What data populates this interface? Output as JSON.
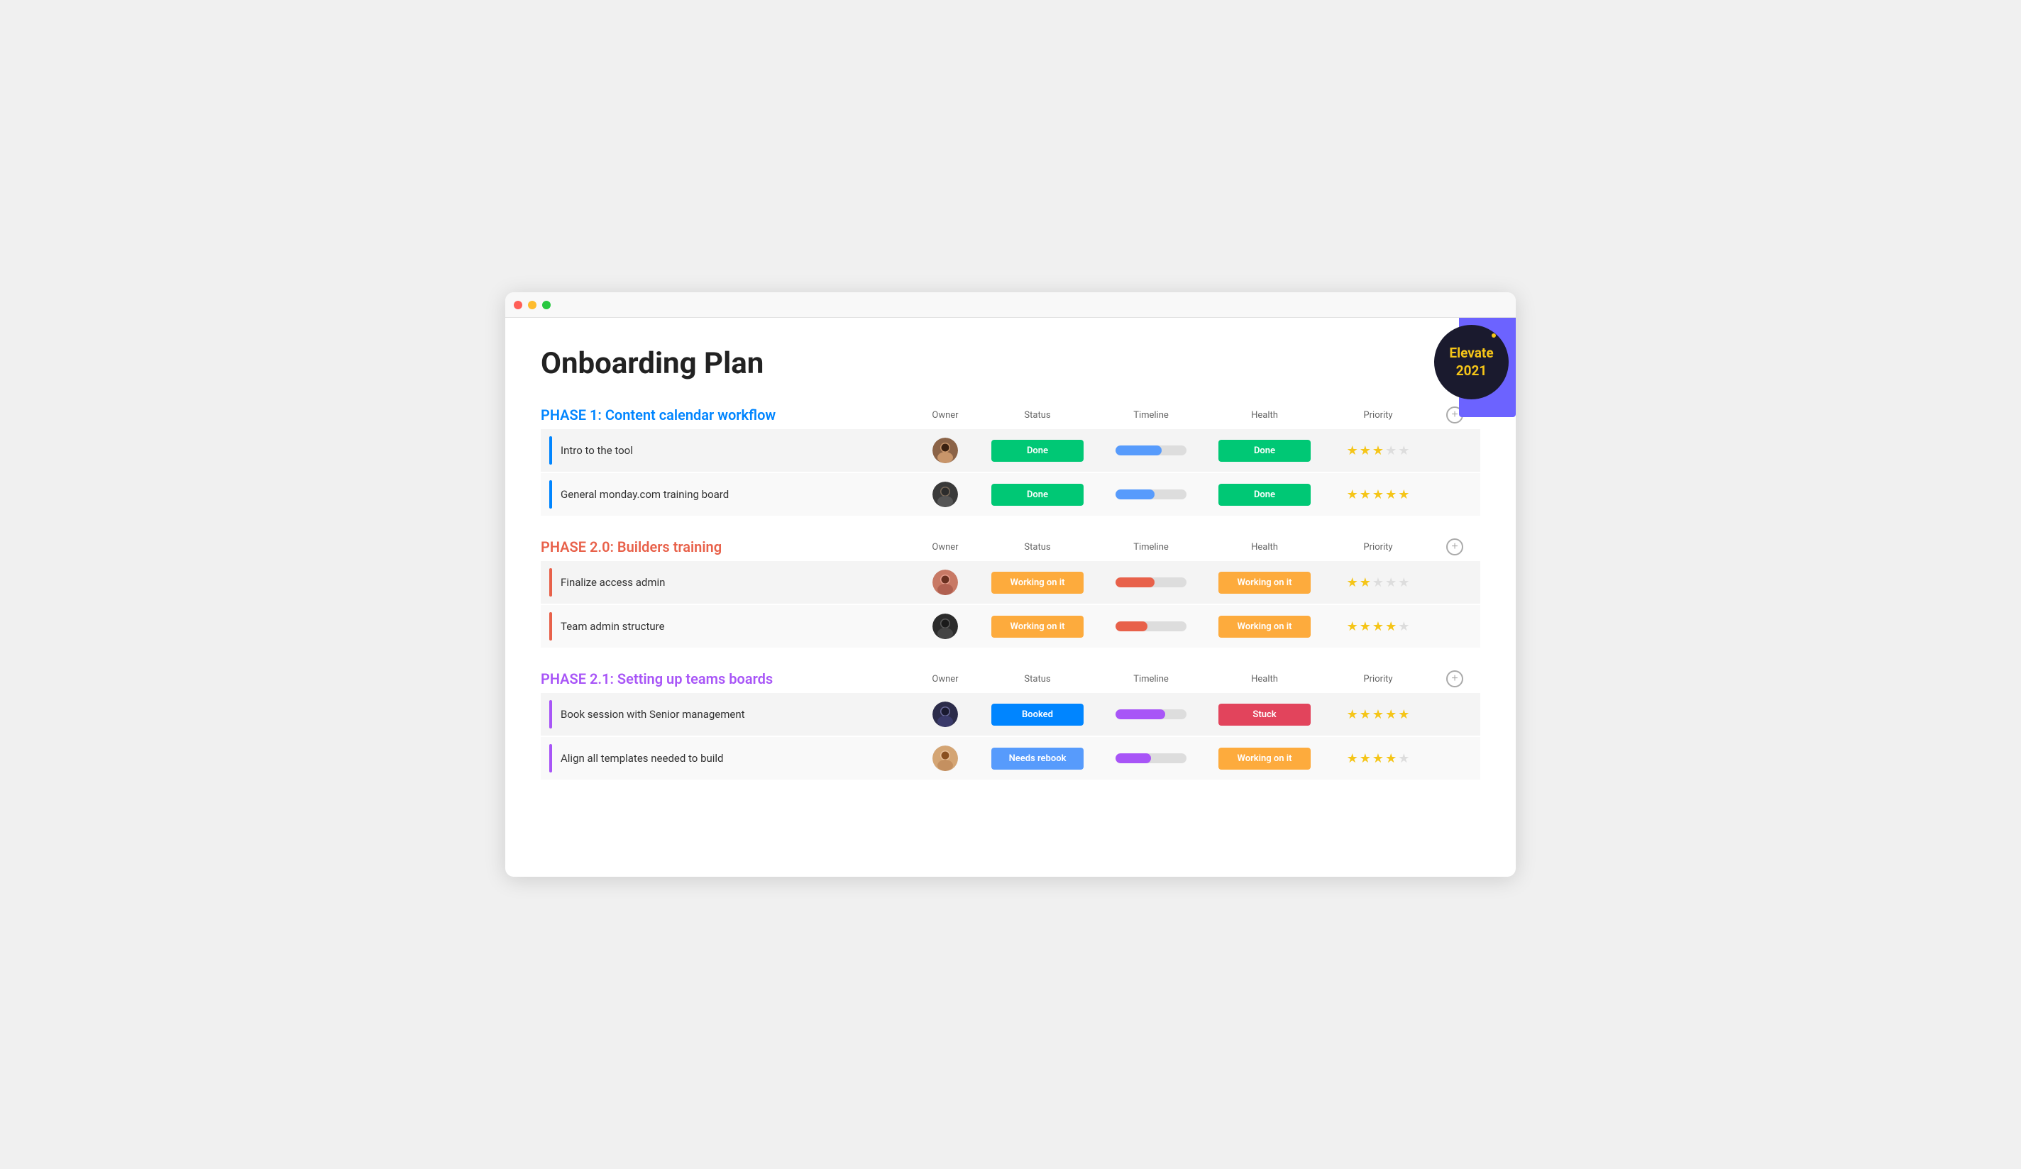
{
  "window": {
    "title": "Onboarding Plan"
  },
  "page": {
    "title": "Onboarding Plan"
  },
  "badge": {
    "line1": "Elevate",
    "line2": "2021"
  },
  "columns": {
    "owner": "Owner",
    "status": "Status",
    "timeline": "Timeline",
    "health": "Health",
    "priority": "Priority"
  },
  "phases": [
    {
      "id": "phase1",
      "title": "PHASE 1: Content calendar workflow",
      "colorClass": "blue",
      "borderClass": "border-blue",
      "tasks": [
        {
          "name": "Intro to the tool",
          "avatar": "av1",
          "avatarEmoji": "👤",
          "status": "Done",
          "statusClass": "status-done",
          "timelineClass": "tl-blue",
          "health": "Done",
          "healthClass": "health-done",
          "stars": 3
        },
        {
          "name": "General monday.com training board",
          "avatar": "av2",
          "avatarEmoji": "👤",
          "status": "Done",
          "statusClass": "status-done",
          "timelineClass": "tl-blue2",
          "health": "Done",
          "healthClass": "health-done",
          "stars": 5
        }
      ]
    },
    {
      "id": "phase2",
      "title": "PHASE 2.0: Builders training",
      "colorClass": "salmon",
      "borderClass": "border-salmon",
      "tasks": [
        {
          "name": "Finalize access admin",
          "avatar": "av3",
          "avatarEmoji": "👤",
          "status": "Working on it",
          "statusClass": "status-working",
          "timelineClass": "tl-orange",
          "health": "Working on it",
          "healthClass": "health-working",
          "stars": 2
        },
        {
          "name": "Team admin structure",
          "avatar": "av4",
          "avatarEmoji": "👤",
          "status": "Working on it",
          "statusClass": "status-working",
          "timelineClass": "tl-orange2",
          "health": "Working on it",
          "healthClass": "health-working",
          "stars": 4
        }
      ]
    },
    {
      "id": "phase21",
      "title": "PHASE 2.1: Setting up teams boards",
      "colorClass": "purple",
      "borderClass": "border-purple",
      "tasks": [
        {
          "name": "Book session with Senior management",
          "avatar": "av5",
          "avatarEmoji": "👤",
          "status": "Booked",
          "statusClass": "status-booked",
          "timelineClass": "tl-purple",
          "health": "Stuck",
          "healthClass": "health-stuck",
          "stars": 5
        },
        {
          "name": "Align all templates needed to build",
          "avatar": "av6",
          "avatarEmoji": "👤",
          "status": "Needs rebook",
          "statusClass": "status-needs-rebook",
          "timelineClass": "tl-purple2",
          "health": "Working on it",
          "healthClass": "health-working",
          "stars": 4
        }
      ]
    }
  ]
}
